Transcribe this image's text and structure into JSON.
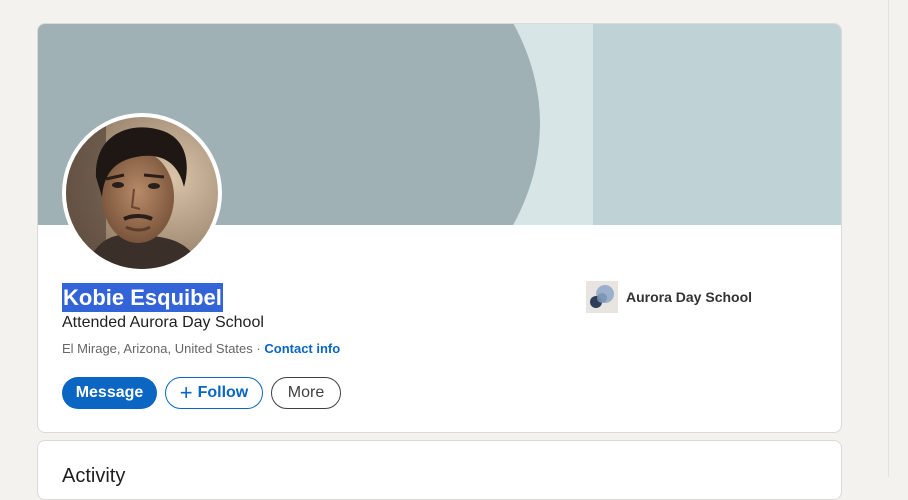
{
  "profile": {
    "name": "Kobie Esquibel",
    "headline": "Attended Aurora Day School",
    "location": "El Mirage, Arizona, United States",
    "separator": "·",
    "contact_info": "Contact info"
  },
  "actions": {
    "message": "Message",
    "follow": "Follow",
    "follow_icon": "+",
    "more": "More"
  },
  "education": {
    "school_name": "Aurora Day School",
    "logo_icon": "school-logo-icon"
  },
  "activity": {
    "title": "Activity"
  },
  "colors": {
    "brand_blue": "#0a66c2",
    "selection_highlight": "#3264d8",
    "banner_base": "#bfd2d6",
    "banner_arc": "#9fb1b4"
  }
}
